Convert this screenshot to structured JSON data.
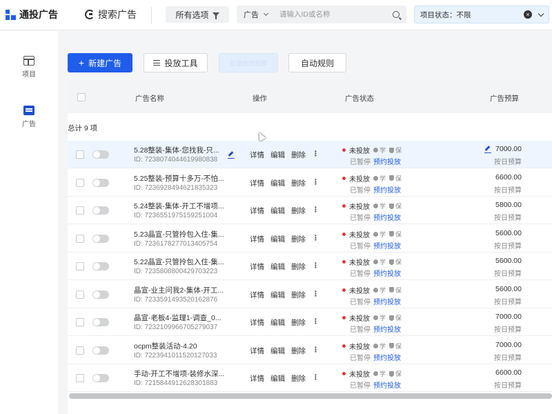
{
  "header": {
    "brand": "通投广告",
    "search_ads": "搜索广告",
    "all_options": "所有选项",
    "search_type": "广告",
    "search_placeholder": "请输入ID或名称",
    "status_filter": "项目状态：不限"
  },
  "nav": {
    "project": "项目",
    "ad": "广告"
  },
  "toolbar": {
    "new_ad": "新建广告",
    "tools": "投放工具",
    "blurred": "批量修改预算",
    "auto_rules": "自动规则"
  },
  "table": {
    "columns": {
      "name": "广告名称",
      "ops": "操作",
      "status": "广告状态",
      "budget": "广告预算"
    },
    "total": "总计 9 项",
    "ops": {
      "detail": "详情",
      "edit": "编辑",
      "delete": "删除"
    },
    "status_primary": "未投放",
    "tag_learn": "学",
    "tag_protect": "保",
    "status_paused": "已暂停",
    "status_link": "预约投放",
    "budget_type": "按日预算",
    "rows": [
      {
        "name": "5.28整装-集体-您找我-只...",
        "id": "ID: 7238074044619980838",
        "budget": "7000.00"
      },
      {
        "name": "5.25整装-预算十多万-不怕...",
        "id": "ID: 7236928494621835323",
        "budget": "6600.00"
      },
      {
        "name": "5.24整装-集体-开工不增项...",
        "id": "ID: 7236551975159251004",
        "budget": "5800.00"
      },
      {
        "name": "5.23晶宣-只管拎包入住-集...",
        "id": "ID: 7236178277013405754",
        "budget": "5600.00"
      },
      {
        "name": "5.22晶宣-只管拎包入住-集...",
        "id": "ID: 7235808800429703223",
        "budget": "5600.00"
      },
      {
        "name": "晶宣-业主问我2-集体-开工...",
        "id": "ID: 7233591493520162876",
        "budget": "5600.00"
      },
      {
        "name": "晶宣-老板4-监理1-调查_0...",
        "id": "ID: 7232109966705279037",
        "budget": "7000.00"
      },
      {
        "name": "ocpm整装活动-4.20",
        "id": "ID: 7223941011520127033",
        "budget": "7000.00"
      },
      {
        "name": "手动-开工不增项-装修水深...",
        "id": "ID: 7215844912628301883",
        "budget": "6600.00"
      }
    ]
  }
}
